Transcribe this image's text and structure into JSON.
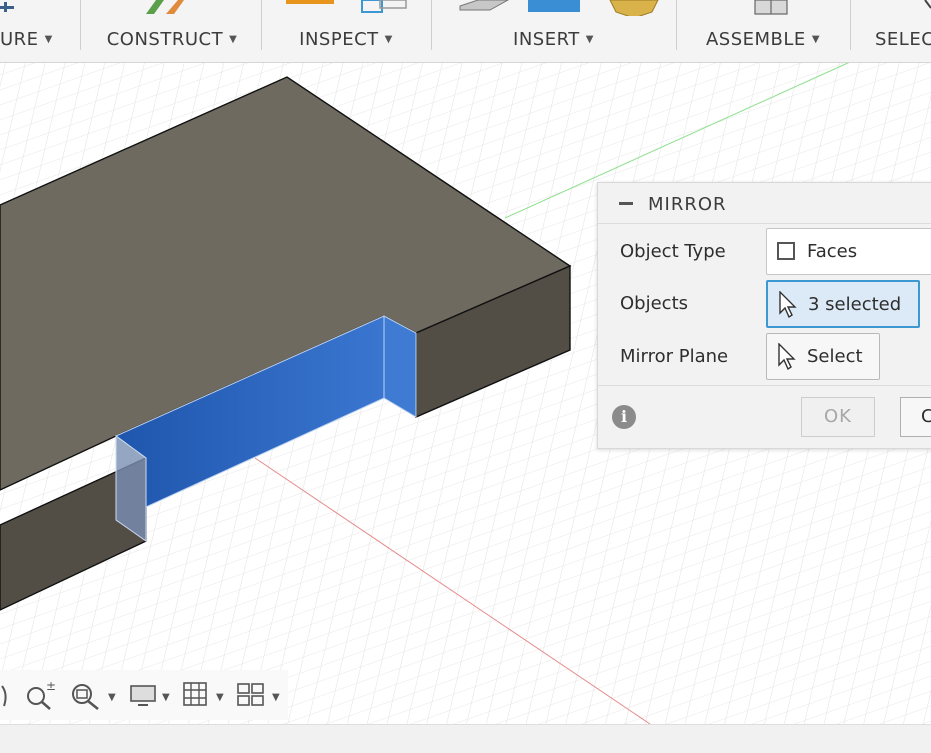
{
  "toolbar": {
    "groups": [
      {
        "label": "URE"
      },
      {
        "label": "CONSTRUCT"
      },
      {
        "label": "INSPECT"
      },
      {
        "label": "INSERT"
      },
      {
        "label": "ASSEMBLE"
      },
      {
        "label": "SELEC"
      }
    ],
    "caret": "▼"
  },
  "dialog": {
    "title": "MIRROR",
    "object_type_label": "Object Type",
    "object_type_value": "Faces",
    "objects_label": "Objects",
    "objects_value": "3 selected",
    "mirror_plane_label": "Mirror Plane",
    "mirror_plane_value": "Select",
    "ok_label": "OK",
    "cancel_label": "C",
    "info_glyph": "i"
  },
  "navbar": {
    "items": [
      "orbit-icon",
      "zoom-icon",
      "zoom-window-icon",
      "display-settings-icon",
      "grid-icon",
      "viewports-icon"
    ],
    "caret": "▼"
  },
  "colors": {
    "body_top": "#6e6a60",
    "body_side": "#524e46",
    "selected_face": "#2a62b8",
    "accent": "#3c97d3",
    "axis_x": "#e58a8a",
    "axis_y": "#8ee08e"
  }
}
